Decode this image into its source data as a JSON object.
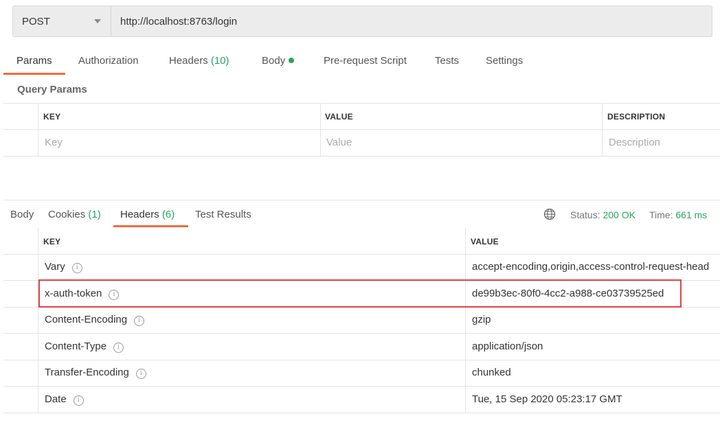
{
  "request": {
    "method": "POST",
    "url": "http://localhost:8763/login"
  },
  "request_tabs": [
    {
      "label": "Params"
    },
    {
      "label": "Authorization"
    },
    {
      "label": "Headers",
      "count": "(10)"
    },
    {
      "label": "Body"
    },
    {
      "label": "Pre-request Script"
    },
    {
      "label": "Tests"
    },
    {
      "label": "Settings"
    }
  ],
  "query_params": {
    "title": "Query Params",
    "headers": [
      "KEY",
      "VALUE",
      "DESCRIPTION"
    ],
    "placeholders": [
      "Key",
      "Value",
      "Description"
    ]
  },
  "response_tabs": [
    {
      "label": "Body"
    },
    {
      "label": "Cookies",
      "count": "(1)"
    },
    {
      "label": "Headers",
      "count": "(6)"
    },
    {
      "label": "Test Results"
    }
  ],
  "status": {
    "status_label": "Status:",
    "status_value": "200 OK",
    "time_label": "Time:",
    "time_value": "661 ms"
  },
  "response_headers": {
    "columns": [
      "KEY",
      "VALUE"
    ],
    "rows": [
      {
        "key": "Vary",
        "value": "accept-encoding,origin,access-control-request-head"
      },
      {
        "key": "x-auth-token",
        "value": "de99b3ec-80f0-4cc2-a988-ce03739525ed"
      },
      {
        "key": "Content-Encoding",
        "value": "gzip"
      },
      {
        "key": "Content-Type",
        "value": "application/json"
      },
      {
        "key": "Transfer-Encoding",
        "value": "chunked"
      },
      {
        "key": "Date",
        "value": "Tue, 15 Sep 2020 05:23:17 GMT"
      }
    ]
  },
  "colors": {
    "accent": "#f26b3a",
    "success": "#26a65b",
    "highlight": "#e04343"
  },
  "icons": {
    "info": "info-icon",
    "globe": "globe-icon",
    "caret": "chevron-down-icon"
  }
}
